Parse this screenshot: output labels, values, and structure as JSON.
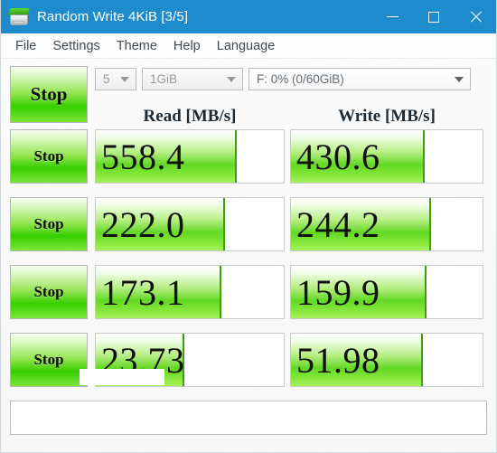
{
  "window": {
    "title": "Random Write 4KiB [3/5]",
    "icon": "disk-drive-icon",
    "controls": {
      "minimize": "minimize-icon",
      "maximize": "maximize-icon",
      "close": "close-icon"
    },
    "titlebar_color": "#1e8bcd"
  },
  "menubar": {
    "items": [
      {
        "label": "File"
      },
      {
        "label": "Settings"
      },
      {
        "label": "Theme"
      },
      {
        "label": "Help"
      },
      {
        "label": "Language"
      }
    ]
  },
  "toolbar": {
    "all_button_label": "Stop",
    "combo_count": {
      "value": "5",
      "enabled": false
    },
    "combo_size": {
      "value": "1GiB",
      "enabled": false
    },
    "combo_drive": {
      "value": "F: 0% (0/60GiB)",
      "enabled": true
    }
  },
  "columns": {
    "read_header": "Read [MB/s]",
    "write_header": "Write [MB/s]"
  },
  "accent": {
    "bar_green": "#62d824",
    "bar_edge": "#3f9f12",
    "button_green": "#36cf00"
  },
  "rows": [
    {
      "button_label": "Stop",
      "read_value": "558.4",
      "read_fill_pct": 74,
      "write_value": "430.6",
      "write_fill_pct": 69
    },
    {
      "button_label": "Stop",
      "read_value": "222.0",
      "read_fill_pct": 68,
      "write_value": "244.2",
      "write_fill_pct": 72
    },
    {
      "button_label": "Stop",
      "read_value": "173.1",
      "read_fill_pct": 66,
      "write_value": "159.9",
      "write_fill_pct": 70
    },
    {
      "button_label": "Stop",
      "read_value": "23.73",
      "read_fill_pct": 46,
      "write_value": "51.98",
      "write_fill_pct": 68
    }
  ],
  "statusbar": {
    "text": ""
  }
}
